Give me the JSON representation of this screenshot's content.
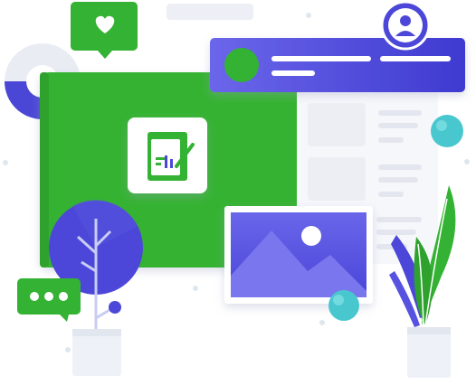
{
  "colors": {
    "green": "#34b233",
    "green_dark": "#2a9a2c",
    "indigo": "#4c47d8",
    "indigo_light": "#6a67e8",
    "teal": "#49c7cf",
    "panel_gray": "#eff1f6",
    "line_gray": "#e3e6ee",
    "white": "#ffffff"
  },
  "icons": {
    "heart": "heart-icon",
    "avatar": "user-avatar-icon",
    "chat": "chat-bubble-icon",
    "app": "document-edit-icon",
    "image": "landscape-image-icon"
  }
}
